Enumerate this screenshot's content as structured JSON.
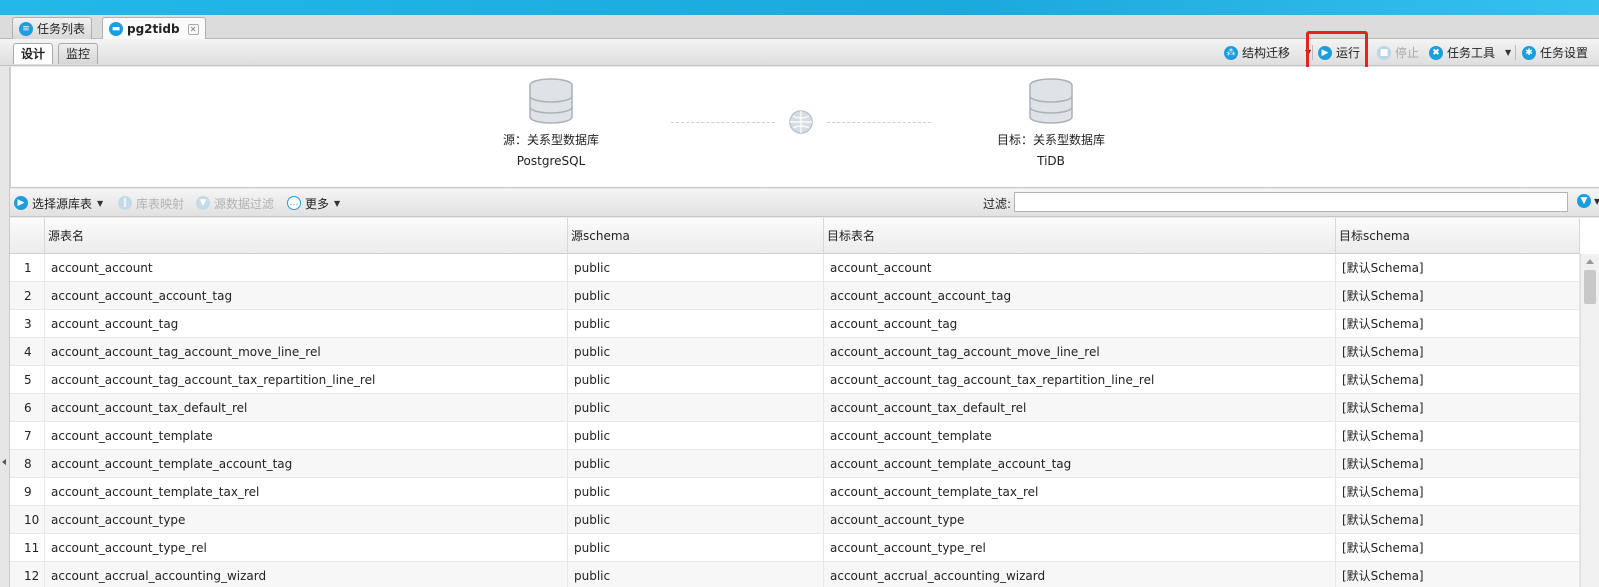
{
  "tabs": [
    {
      "label": "任务列表",
      "icon": "list-icon",
      "active": false
    },
    {
      "label": "pg2tidb",
      "icon": "folder-icon",
      "active": true,
      "close": "✕"
    }
  ],
  "subtabs": [
    "设计",
    "监控"
  ],
  "toolbar": {
    "structure_migrate": "结构迁移",
    "run": "运行",
    "stop": "停止",
    "task_tools": "任务工具",
    "task_settings": "任务设置"
  },
  "source": {
    "label": "源：关系型数据库",
    "db": "PostgreSQL"
  },
  "target": {
    "label": "目标：关系型数据库",
    "db": "TiDB"
  },
  "filterbar": {
    "select_tables": "选择源库表",
    "table_mapping": "库表映射",
    "data_filter": "源数据过滤",
    "more": "更多",
    "filter_label": "过滤:",
    "filter_value": ""
  },
  "grid": {
    "columns": [
      "",
      "源表名",
      "源schema",
      "目标表名",
      "目标schema"
    ],
    "rows": [
      [
        "1",
        "account_account",
        "public",
        "account_account",
        "[默认Schema]"
      ],
      [
        "2",
        "account_account_account_tag",
        "public",
        "account_account_account_tag",
        "[默认Schema]"
      ],
      [
        "3",
        "account_account_tag",
        "public",
        "account_account_tag",
        "[默认Schema]"
      ],
      [
        "4",
        "account_account_tag_account_move_line_rel",
        "public",
        "account_account_tag_account_move_line_rel",
        "[默认Schema]"
      ],
      [
        "5",
        "account_account_tag_account_tax_repartition_line_rel",
        "public",
        "account_account_tag_account_tax_repartition_line_rel",
        "[默认Schema]"
      ],
      [
        "6",
        "account_account_tax_default_rel",
        "public",
        "account_account_tax_default_rel",
        "[默认Schema]"
      ],
      [
        "7",
        "account_account_template",
        "public",
        "account_account_template",
        "[默认Schema]"
      ],
      [
        "8",
        "account_account_template_account_tag",
        "public",
        "account_account_template_account_tag",
        "[默认Schema]"
      ],
      [
        "9",
        "account_account_template_tax_rel",
        "public",
        "account_account_template_tax_rel",
        "[默认Schema]"
      ],
      [
        "10",
        "account_account_type",
        "public",
        "account_account_type",
        "[默认Schema]"
      ],
      [
        "11",
        "account_account_type_rel",
        "public",
        "account_account_type_rel",
        "[默认Schema]"
      ],
      [
        "12",
        "account_accrual_accounting_wizard",
        "public",
        "account_accrual_accounting_wizard",
        "[默认Schema]"
      ]
    ]
  },
  "colors": {
    "accent": "#1d9de0",
    "highlight": "#e52420"
  }
}
